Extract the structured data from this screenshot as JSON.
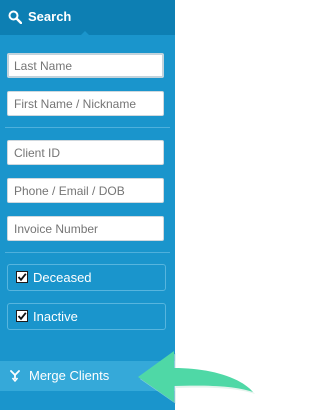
{
  "header": {
    "title": "Search",
    "icon": "search-icon"
  },
  "fields": {
    "last_name": {
      "placeholder": "Last Name"
    },
    "first_name": {
      "placeholder": "First Name / Nickname"
    },
    "client_id": {
      "placeholder": "Client ID"
    },
    "contact": {
      "placeholder": "Phone / Email / DOB"
    },
    "invoice": {
      "placeholder": "Invoice Number"
    }
  },
  "filters": {
    "deceased": {
      "label": "Deceased",
      "checked": true
    },
    "inactive": {
      "label": "Inactive",
      "checked": true
    }
  },
  "merge": {
    "label": "Merge Clients",
    "icon": "merge-icon"
  },
  "colors": {
    "sidebar": "#1a95cc",
    "header": "#0d7fb3",
    "merge_bar": "#35a9d9",
    "arrow": "#4fd8a6"
  }
}
